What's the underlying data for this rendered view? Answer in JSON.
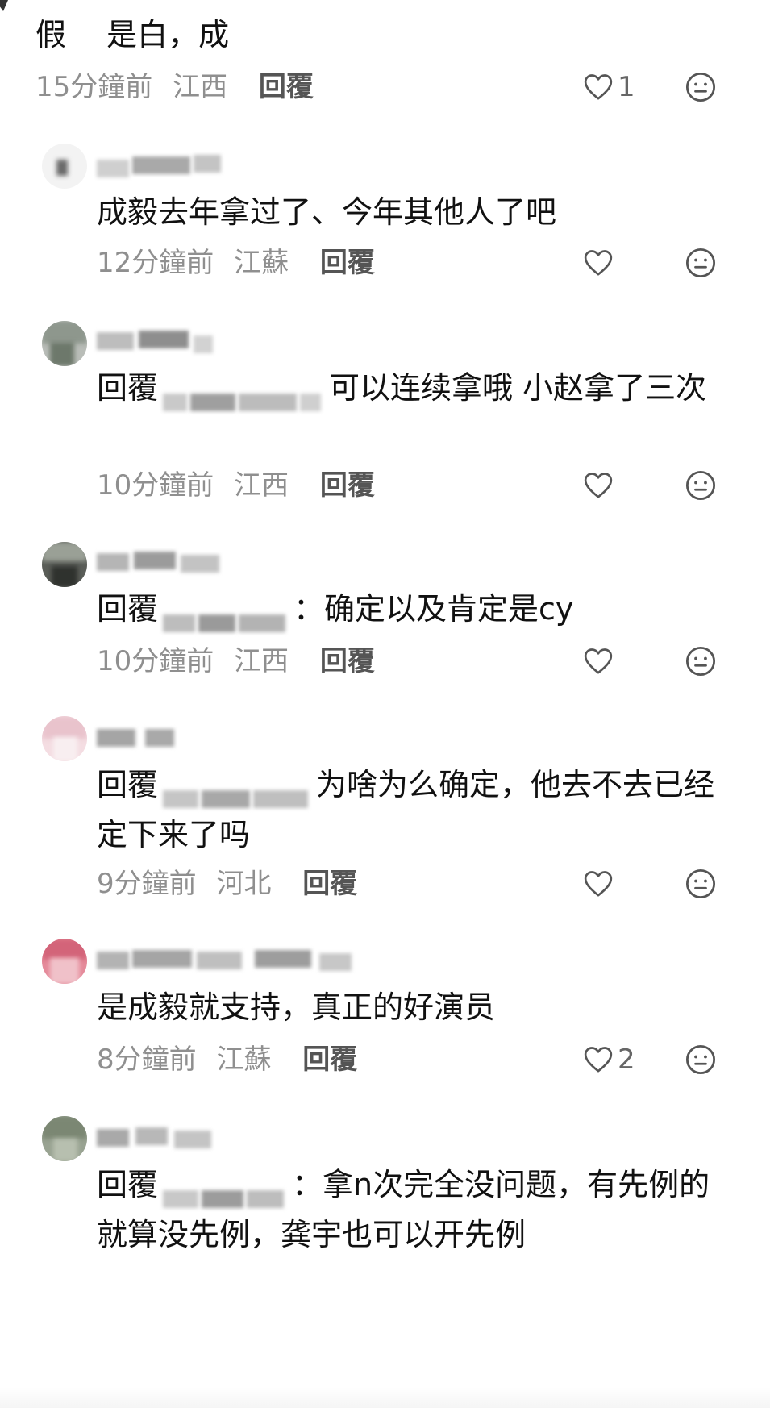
{
  "comments": [
    {
      "text": "假　 是白，成",
      "time": "15分鐘前",
      "location": "江西",
      "reply_label": "回覆",
      "likes": "1"
    },
    {
      "text": "成毅去年拿过了、今年其他人了吧",
      "time": "12分鐘前",
      "location": "江蘇",
      "reply_label": "回覆",
      "likes": ""
    },
    {
      "reply_prefix": "回覆",
      "text": "可以连续拿哦  小赵拿了三次",
      "time": "10分鐘前",
      "location": "江西",
      "reply_label": "回覆",
      "likes": ""
    },
    {
      "reply_prefix": "回覆",
      "text": "：确定以及肯定是cy",
      "time": "10分鐘前",
      "location": "江西",
      "reply_label": "回覆",
      "likes": ""
    },
    {
      "reply_prefix": "回覆",
      "text": "为啥为么确定，他去不去已经定下来了吗",
      "time": "9分鐘前",
      "location": "河北",
      "reply_label": "回覆",
      "likes": ""
    },
    {
      "text": "是成毅就支持，真正的好演员",
      "time": "8分鐘前",
      "location": "江蘇",
      "reply_label": "回覆",
      "likes": "2"
    },
    {
      "reply_prefix": "回覆",
      "text": "：拿n次完全没问题，有先例的  就算没先例，龚宇也可以开先例"
    }
  ],
  "icons": {
    "like": "heart-outline-icon",
    "dislike": "neutral-face-icon"
  },
  "colors": {
    "text": "#111111",
    "meta": "#8f8f8f",
    "icon": "#555555"
  }
}
